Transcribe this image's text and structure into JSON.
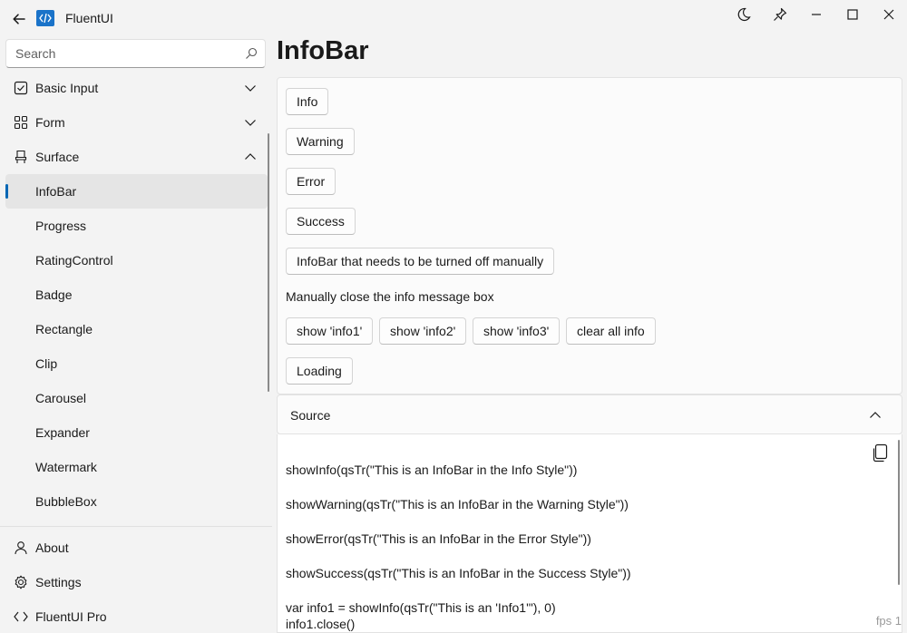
{
  "window": {
    "app_title": "FluentUI"
  },
  "sidebar": {
    "search_placeholder": "Search",
    "items": [
      {
        "label": "Basic Input"
      },
      {
        "label": "Form"
      },
      {
        "label": "Surface"
      },
      {
        "label": "InfoBar"
      },
      {
        "label": "Progress"
      },
      {
        "label": "RatingControl"
      },
      {
        "label": "Badge"
      },
      {
        "label": "Rectangle"
      },
      {
        "label": "Clip"
      },
      {
        "label": "Carousel"
      },
      {
        "label": "Expander"
      },
      {
        "label": "Watermark"
      },
      {
        "label": "BubbleBox"
      }
    ],
    "bottom_items": [
      {
        "label": "About"
      },
      {
        "label": "Settings"
      },
      {
        "label": "FluentUI Pro"
      }
    ],
    "selected": "InfoBar"
  },
  "main": {
    "title": "InfoBar",
    "buttons": {
      "info": "Info",
      "warning": "Warning",
      "error": "Error",
      "success": "Success",
      "manual": "InfoBar that needs to be turned off manually",
      "show_info1": "show 'info1'",
      "show_info2": "show 'info2'",
      "show_info3": "show 'info3'",
      "clear_all": "clear all info",
      "loading": "Loading"
    },
    "manual_close_text": "Manually close the info message box",
    "source_label": "Source",
    "code_lines": [
      "showInfo(qsTr(\"This is an InfoBar in the Info Style\"))",
      "showWarning(qsTr(\"This is an InfoBar in the Warning Style\"))",
      "showError(qsTr(\"This is an InfoBar in the Error Style\"))",
      "showSuccess(qsTr(\"This is an InfoBar in the Success Style\"))",
      "var info1 = showInfo(qsTr(\"This is an 'Info1'\"), 0)",
      "info1.close()"
    ]
  },
  "status": {
    "fps": "fps 1"
  },
  "colors": {
    "accent": "#0066b4",
    "background": "#f3f3f3",
    "selected_bg": "#e5e5e5"
  }
}
